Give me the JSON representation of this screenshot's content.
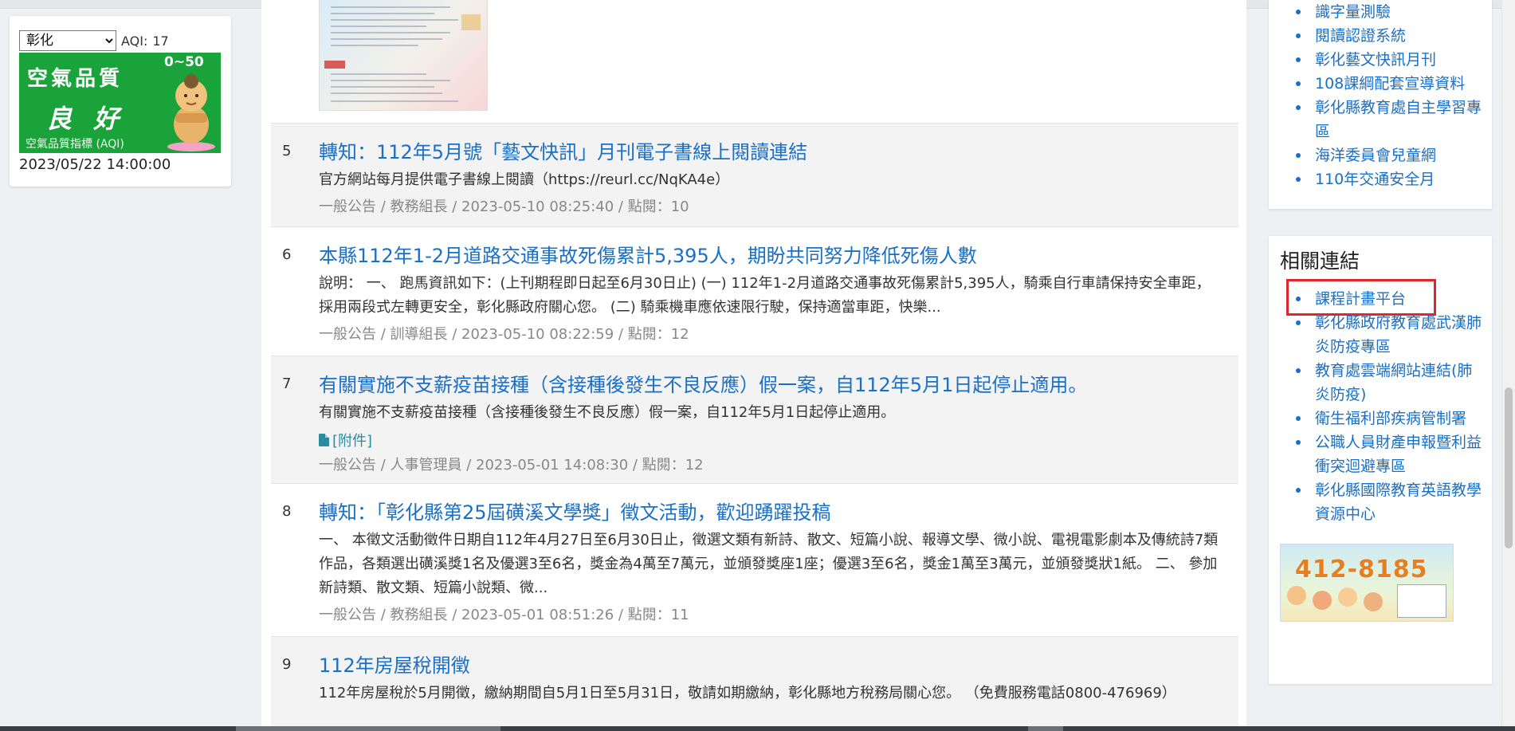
{
  "aqi": {
    "region": "彰化",
    "label": "AQI:",
    "value": "17",
    "banner_title": "空氣品質",
    "banner_range": "0~50",
    "banner_status": "良 好",
    "banner_caption": "空氣品質指標 (AQI)",
    "timestamp": "2023/05/22 14:00:00"
  },
  "news": [
    {
      "num": "5",
      "title": "轉知：112年5月號「藝文快訊」月刊電子書線上閱讀連結",
      "summary": "官方網站每月提供電子書線上閱讀（https://reurl.cc/NqKA4e）",
      "meta": "一般公告 / 教務組長 / 2023-05-10 08:25:40 / 點閱：10"
    },
    {
      "num": "6",
      "title": "本縣112年1-2月道路交通事故死傷累計5,395人，期盼共同努力降低死傷人數",
      "summary": "說明： 一、 跑馬資訊如下：(上刊期程即日起至6月30日止) (一) 112年1-2月道路交通事故死傷累計5,395人，騎乘自行車請保持安全車距，採用兩段式左轉更安全，彰化縣政府關心您。 (二) 騎乘機車應依速限行駛，保持適當車距，快樂...",
      "meta": "一般公告 / 訓導組長 / 2023-05-10 08:22:59 / 點閱：12"
    },
    {
      "num": "7",
      "title": "有關實施不支薪疫苗接種（含接種後發生不良反應）假一案，自112年5月1日起停止適用。",
      "summary": "有關實施不支薪疫苗接種（含接種後發生不良反應）假一案，自112年5月1日起停止適用。",
      "attachment": "[附件]",
      "meta": "一般公告 / 人事管理員 / 2023-05-01 14:08:30 / 點閱：12"
    },
    {
      "num": "8",
      "title": "轉知：「彰化縣第25屆磺溪文學獎」徵文活動，歡迎踴躍投稿",
      "summary": "一、 本徵文活動徵件日期自112年4月27日至6月30日止，徵選文類有新詩、散文、短篇小說、報導文學、微小說、電視電影劇本及傳統詩7類作品，各類選出磺溪獎1名及優選3至6名，獎金為4萬至7萬元，並頒發獎座1座；優選3至6名，獎金1萬至3萬元，並頒發獎狀1紙。 二、 參加新詩類、散文類、短篇小說類、微...",
      "meta": "一般公告 / 教務組長 / 2023-05-01 08:51:26 / 點閱：11"
    },
    {
      "num": "9",
      "title": "112年房屋稅開徵",
      "summary": "112年房屋稅於5月開徵，繳納期間自5月1日至5月31日，敬請如期繳納，彰化縣地方稅務局關心您。 （免費服務電話0800-476969）"
    }
  ],
  "sidebar_top": {
    "items": [
      "識字量測驗",
      "閱讀認證系統",
      "彰化藝文快訊月刊",
      "108課綱配套宣導資料",
      "彰化縣教育處自主學習專區",
      "海洋委員會兒童網",
      "110年交通安全月"
    ]
  },
  "related": {
    "title": "相關連結",
    "items": [
      "課程計畫平台",
      "彰化縣政府教育處武漢肺炎防疫專區",
      "教育處雲端網站連結(肺炎防疫)",
      "衛生福利部疾病管制署",
      "公職人員財產申報暨利益衝突迴避專區",
      "彰化縣國際教育英語教學資源中心"
    ],
    "banner_phone": "412-8185"
  }
}
